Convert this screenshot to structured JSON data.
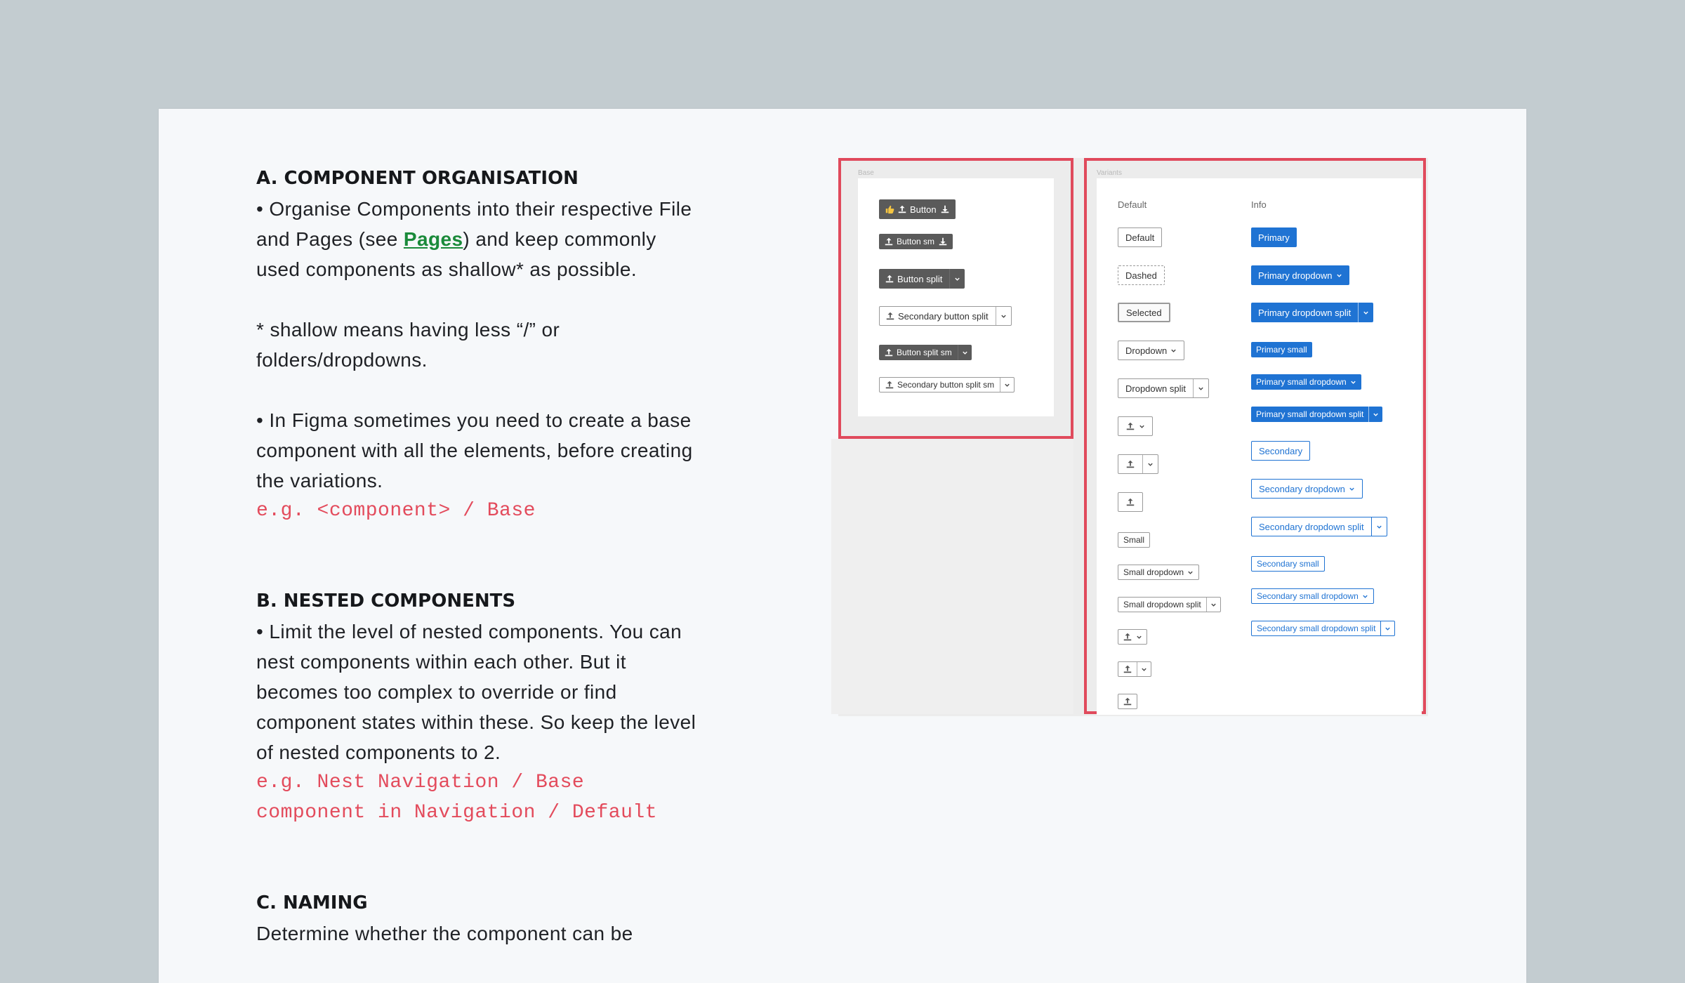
{
  "sections": [
    {
      "heading": "A. COMPONENT ORGANISATION",
      "para1_before_link": "• Organise Components into their respective File and Pages (see ",
      "para1_link": "Pages",
      "para1_after_link": ") and keep commonly used components as shallow* as possible.",
      "para2": "* shallow means having less “/” or folders/dropdowns.",
      "para3": "• In Figma sometimes you need to create a base component with all the elements, before creating the variations.",
      "example": "e.g. <component> / Base"
    },
    {
      "heading": "B. NESTED COMPONENTS",
      "para1": "• Limit the level of nested components. You can nest components within each other. But it becomes too complex to override or find component states within these. So keep the level of nested components to 2.",
      "example_line1": "e.g. Nest Navigation / Base",
      "example_line2": "component in Navigation / Default"
    },
    {
      "heading": "C. NAMING",
      "para1": "Determine whether the component can be"
    }
  ],
  "figure": {
    "base_tag": "Base",
    "variants_tag": "Variants",
    "base_buttons": [
      "Button",
      "Button sm",
      "Button split",
      "Secondary button split",
      "Button split sm",
      "Secondary button split sm"
    ],
    "default_header": "Default",
    "info_header": "Info",
    "default_buttons": [
      "Default",
      "Dashed",
      "Selected",
      "Dropdown",
      "Dropdown split",
      "Small",
      "Small dropdown",
      "Small dropdown split"
    ],
    "info_buttons": [
      "Primary",
      "Primary dropdown",
      "Primary dropdown split",
      "Primary small",
      "Primary small dropdown",
      "Primary small dropdown split",
      "Secondary",
      "Secondary dropdown",
      "Secondary dropdown split",
      "Secondary small",
      "Secondary small dropdown",
      "Secondary small dropdown split"
    ]
  },
  "colors": {
    "accent_red": "#e04a5c",
    "link_green": "#1a8a3a",
    "code_red": "#e34b5c",
    "primary_blue": "#1f73d3"
  }
}
